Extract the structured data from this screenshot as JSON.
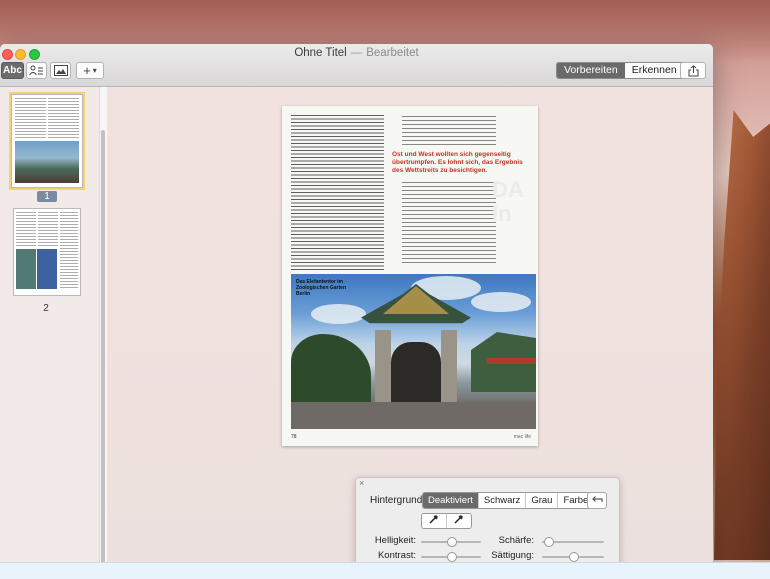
{
  "window": {
    "title": "Ohne Titel",
    "title_separator": "—",
    "title_status": "Bearbeitet"
  },
  "toolbar": {
    "text_tool_label": "Abc",
    "add_label": "+",
    "mode_prepare": "Vorbereiten",
    "mode_recognize": "Erkennen"
  },
  "sidebar": {
    "pages": [
      {
        "number": "1",
        "selected": true
      },
      {
        "number": "2",
        "selected": false
      }
    ]
  },
  "document": {
    "red_heading": "Ost und West wollten sich gegenseitig übertrumpfen. Es lohnt sich, das Ergebnis des Wettstreits zu besichtigen.",
    "ghost_text": "DA\nIn",
    "photo_caption": "Das Elefantentor im Zoologischen Garten Berlin",
    "page_number": "78",
    "footer_right": "mac life"
  },
  "adjust_panel": {
    "background_label": "Hintergrund:",
    "background_options": [
      "Deaktiviert",
      "Schwarz",
      "Grau",
      "Farbe"
    ],
    "background_selected": "Deaktiviert",
    "brightness_label": "Helligkeit:",
    "contrast_label": "Kontrast:",
    "sharpness_label": "Schärfe:",
    "saturation_label": "Sättigung:",
    "brightness_value": 0.5,
    "contrast_value": 0.5,
    "sharpness_value": 0.1,
    "saturation_value": 0.5
  },
  "colors": {
    "close": "#fc5f57",
    "minimize": "#fdbc2e",
    "maximize": "#28c840",
    "selection_outline": "#efd56d",
    "heading_red": "#c9302c"
  }
}
